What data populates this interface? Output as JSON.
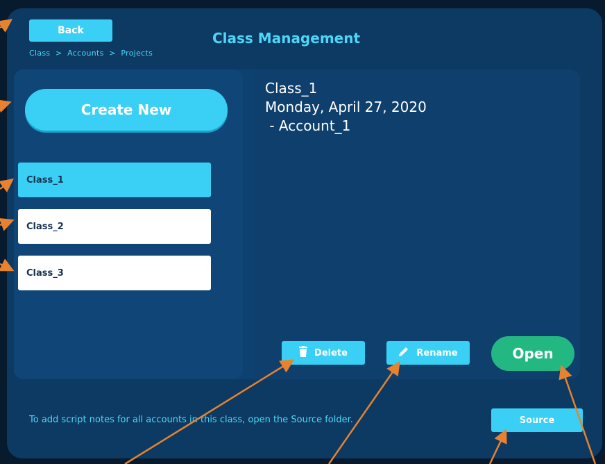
{
  "header": {
    "back_label": "Back",
    "title": "Class Management",
    "breadcrumb": "Class  >  Accounts  >  Projects"
  },
  "sidebar": {
    "create_label": "Create New",
    "classes": [
      {
        "label": "Class_1",
        "selected": true
      },
      {
        "label": "Class_2",
        "selected": false
      },
      {
        "label": "Class_3",
        "selected": false
      }
    ]
  },
  "detail": {
    "line1": "Class_1",
    "line2": "Monday, April 27, 2020",
    "line3": " - Account_1"
  },
  "actions": {
    "delete_label": "Delete",
    "rename_label": "Rename",
    "open_label": "Open"
  },
  "footer": {
    "note": "To add script notes for all accounts in this class, open the Source folder.",
    "source_label": "Source"
  },
  "colors": {
    "accent": "#3ad0f5",
    "open_green": "#23b882",
    "panel": "#0c3a63",
    "annotation_arrow": "#e8822e"
  },
  "icons": {
    "delete": "trash-icon",
    "rename": "pencil-icon"
  }
}
